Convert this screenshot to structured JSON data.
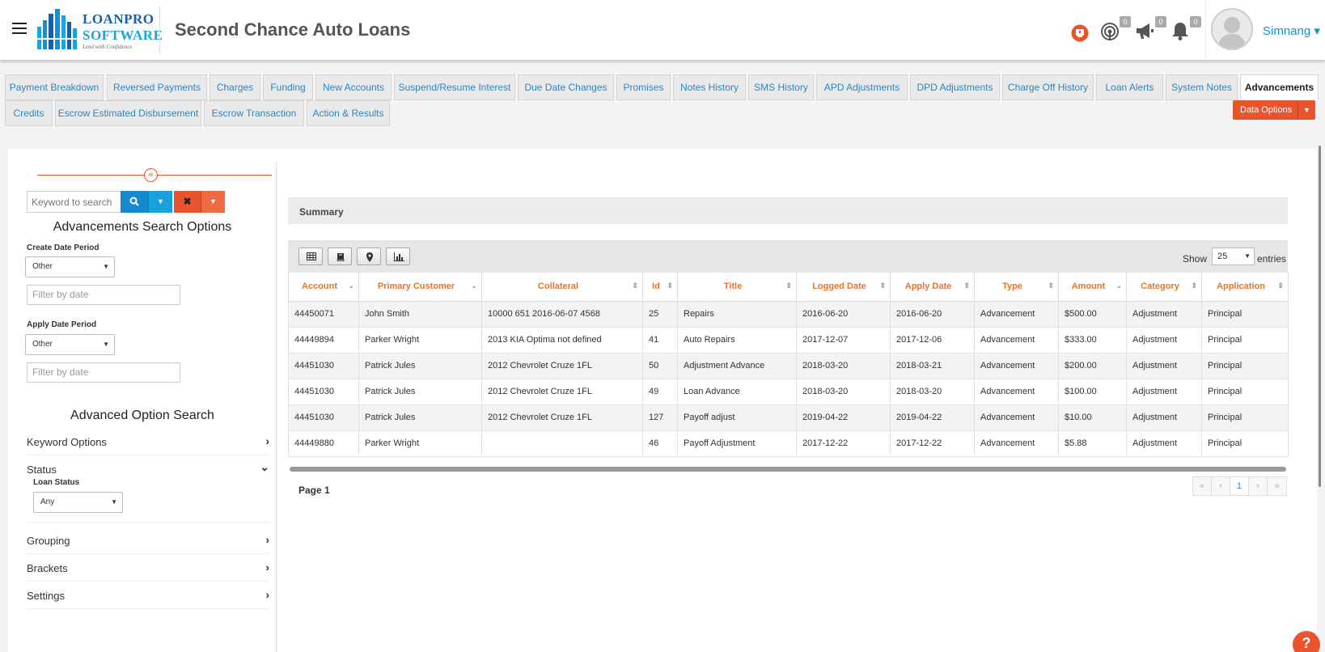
{
  "header": {
    "logo": {
      "line1": "LOANPRO",
      "line2": "SOFTWARE",
      "tagline": "Lend with Confidence"
    },
    "company_name": "Second Chance Auto Loans",
    "icons": [
      {
        "name": "alert-icon",
        "color": "#e8542e"
      },
      {
        "name": "fingerprint-icon",
        "badge": "0"
      },
      {
        "name": "megaphone-icon",
        "badge": "0"
      },
      {
        "name": "bell-icon",
        "badge": "0"
      }
    ],
    "user": {
      "name": "Simnang",
      "caret": "▾"
    }
  },
  "tabs": {
    "row1": [
      "Payment Breakdown",
      "Reversed Payments",
      "Charges",
      "Funding",
      "New Accounts",
      "Suspend/Resume Interest",
      "Due Date Changes",
      "Promises",
      "Notes History",
      "SMS History",
      "APD Adjustments",
      "DPD Adjustments",
      "Charge Off History",
      "Loan Alerts",
      "System Notes",
      "Advancements"
    ],
    "row2": [
      "Credits",
      "Escrow Estimated Disbursement",
      "Escrow Transaction",
      "Action & Results"
    ],
    "active": "Advancements",
    "data_options": "Data Options"
  },
  "sidebar": {
    "collapse_icon": "«",
    "search": {
      "placeholder": "Keyword to search"
    },
    "heading": "Advancements Search Options",
    "create_date": {
      "label": "Create Date Period",
      "value": "Other",
      "placeholder": "Filter by date"
    },
    "apply_date": {
      "label": "Apply Date Period",
      "value": "Other",
      "placeholder": "Filter by date"
    },
    "advanced_heading": "Advanced Option Search",
    "keyword_options": "Keyword Options",
    "status": {
      "label": "Status",
      "loan_status_label": "Loan Status",
      "loan_status_value": "Any"
    },
    "grouping": "Grouping",
    "brackets": "Brackets",
    "settings": "Settings"
  },
  "content": {
    "summary_label": "Summary",
    "toolbar_icons": [
      "table-icon",
      "book-icon",
      "map-marker-icon",
      "bar-chart-icon"
    ],
    "show_label": "Show",
    "page_size": "25",
    "entries_label": "entries",
    "columns": [
      {
        "label": "Account",
        "sort": "⌄"
      },
      {
        "label": "Primary Customer",
        "sort": "⌄"
      },
      {
        "label": "Collateral",
        "sort": "⇕"
      },
      {
        "label": "Id",
        "sort": "⇕"
      },
      {
        "label": "Title",
        "sort": "⇕"
      },
      {
        "label": "Logged Date",
        "sort": "⇕"
      },
      {
        "label": "Apply Date",
        "sort": "⇕"
      },
      {
        "label": "Type",
        "sort": "⇕"
      },
      {
        "label": "Amount",
        "sort": "⌄"
      },
      {
        "label": "Category",
        "sort": "⇕"
      },
      {
        "label": "Application",
        "sort": "⇕"
      }
    ],
    "rows": [
      [
        "44450071",
        "John Smith",
        "10000 651 2016-06-07 4568",
        "25",
        "Repairs",
        "2016-06-20",
        "2016-06-20",
        "Advancement",
        "$500.00",
        "Adjustment",
        "Principal"
      ],
      [
        "44449894",
        "Parker Wright",
        "2013 KIA Optima not defined",
        "41",
        "Auto Repairs",
        "2017-12-07",
        "2017-12-06",
        "Advancement",
        "$333.00",
        "Adjustment",
        "Principal"
      ],
      [
        "44451030",
        "Patrick Jules",
        "2012 Chevrolet Cruze 1FL",
        "50",
        "Adjustment Advance",
        "2018-03-20",
        "2018-03-21",
        "Advancement",
        "$200.00",
        "Adjustment",
        "Principal"
      ],
      [
        "44451030",
        "Patrick Jules",
        "2012 Chevrolet Cruze 1FL",
        "49",
        "Loan Advance",
        "2018-03-20",
        "2018-03-20",
        "Advancement",
        "$100.00",
        "Adjustment",
        "Principal"
      ],
      [
        "44451030",
        "Patrick Jules",
        "2012 Chevrolet Cruze 1FL",
        "127",
        "Payoff adjust",
        "2019-04-22",
        "2019-04-22",
        "Advancement",
        "$10.00",
        "Adjustment",
        "Principal"
      ],
      [
        "44449880",
        "Parker Wright",
        "",
        "46",
        "Payoff Adjustment",
        "2017-12-22",
        "2017-12-22",
        "Advancement",
        "$5.88",
        "Adjustment",
        "Principal"
      ]
    ],
    "page_label": "Page 1",
    "pager": [
      "«",
      "‹",
      "1",
      "›",
      "»"
    ],
    "current_page": "1"
  },
  "help_label": "?",
  "colors": {
    "accent": "#e8542e",
    "link": "#2a86c4",
    "header_text": "#e8742c"
  }
}
